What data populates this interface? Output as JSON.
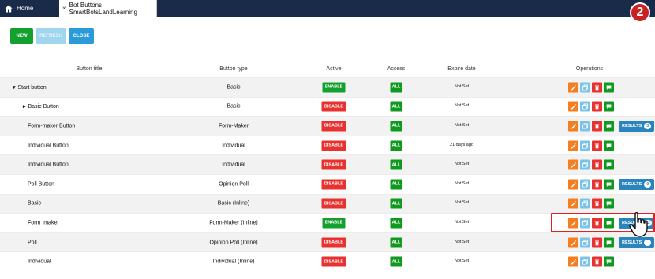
{
  "tabs": {
    "home_label": "Home",
    "active_label": "Bot Buttons SmartBotsLandLearning",
    "close_glyph": "×"
  },
  "step_badge": "2",
  "toolbar": {
    "new_label": "NEW",
    "refresh_label": "REFRESH",
    "close_label": "CLOSE"
  },
  "columns": {
    "title": "Button title",
    "type": "Button type",
    "active": "Active",
    "access": "Access",
    "expire": "Expire date",
    "operations": "Operations"
  },
  "rows": [
    {
      "title": "Start button",
      "chevron": "down",
      "type": "Basic",
      "active": "ENABLE",
      "access": "ALL",
      "expire": "Not Set",
      "results": null
    },
    {
      "title": "Basic Button",
      "chevron": "right",
      "type": "Basic",
      "active": "DISABLE",
      "access": "ALL",
      "expire": "Not Set",
      "results": null
    },
    {
      "title": "Form-maker Button",
      "chevron": null,
      "type": "Form-Maker",
      "active": "DISABLE",
      "access": "ALL",
      "expire": "Not Set",
      "results": {
        "label": "RESULTS",
        "count": "3"
      }
    },
    {
      "title": "Individual Button",
      "chevron": null,
      "type": "Individual",
      "active": "DISABLE",
      "access": "ALL",
      "expire": "21 days ago",
      "results": null
    },
    {
      "title": "Individual Button",
      "chevron": null,
      "type": "Individual",
      "active": "DISABLE",
      "access": "ALL",
      "expire": "Not Set",
      "results": null
    },
    {
      "title": "Poll Button",
      "chevron": null,
      "type": "Opinion Poll",
      "active": "DISABLE",
      "access": "ALL",
      "expire": "Not Set",
      "results": {
        "label": "RESULTS",
        "count": "0"
      }
    },
    {
      "title": "Basic",
      "chevron": null,
      "type": "Basic (Inline)",
      "active": "DISABLE",
      "access": "ALL",
      "expire": "Not Set",
      "results": null
    },
    {
      "title": "Form_maker",
      "chevron": null,
      "type": "Form-Maker (Inline)",
      "active": "ENABLE",
      "access": "ALL",
      "expire": "Not Set",
      "results": {
        "label": "RESULTS",
        "count": "12"
      }
    },
    {
      "title": "Poll",
      "chevron": null,
      "type": "Opinion Poll (Inline)",
      "active": "DISABLE",
      "access": "ALL",
      "expire": "Not Set",
      "results": {
        "label": "RESULTS",
        "count": ""
      }
    },
    {
      "title": "Individual",
      "chevron": null,
      "type": "Individual (Inline)",
      "active": "DISABLE",
      "access": "ALL",
      "expire": "Not Set",
      "results": null
    }
  ],
  "colors": {
    "topbar": "#1a2b4a",
    "enable": "#14a02e",
    "disable": "#e8322f",
    "edit": "#f47e20",
    "copy": "#7dc3e7",
    "delete": "#e8322f",
    "chat": "#0f9a1f",
    "results": "#2a84be",
    "highlight": "#e02222"
  },
  "icons": [
    "home-icon",
    "close-icon",
    "chevron-down-icon",
    "chevron-right-icon",
    "pencil-icon",
    "copy-icon",
    "trash-icon",
    "chat-icon",
    "hand-pointer-icon"
  ]
}
